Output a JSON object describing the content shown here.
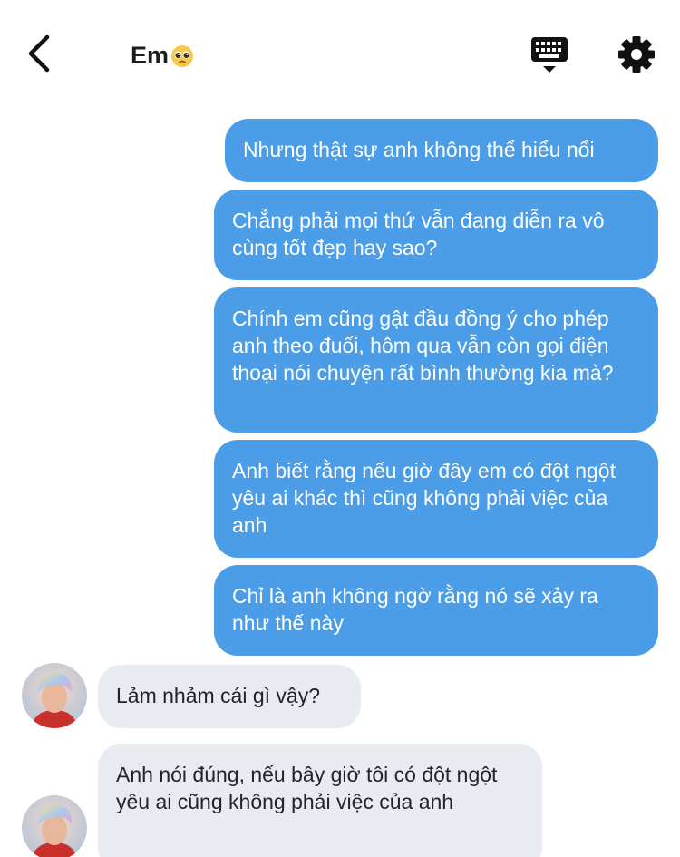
{
  "header": {
    "title": "Em",
    "title_emoji": "pleading-face-emoji",
    "back_icon": "chevron-left-icon",
    "keyboard_icon": "keyboard-icon",
    "settings_icon": "gear-icon"
  },
  "colors": {
    "outgoing_bubble": "#4b9de7",
    "incoming_bubble": "#e8ebf0"
  },
  "messages": [
    {
      "sender": "me",
      "text": "Nhưng thật sự anh không thể hiểu nổi"
    },
    {
      "sender": "me",
      "text": "Chẳng phải mọi thứ vẫn đang diễn ra vô cùng tốt đẹp hay sao?"
    },
    {
      "sender": "me",
      "text": "Chính em cũng gật đầu đồng ý cho phép anh theo đuổi, hôm qua vẫn còn gọi điện thoại nói chuyện rất bình thường kia mà?"
    },
    {
      "sender": "me",
      "text": "Anh biết rằng nếu giờ đây em có đột ngột yêu ai khác thì cũng không phải việc của anh"
    },
    {
      "sender": "me",
      "text": "Chỉ là anh không ngờ rằng nó sẽ xảy ra như thế này"
    },
    {
      "sender": "them",
      "text": "Lảm nhảm cái gì vậy?"
    },
    {
      "sender": "them",
      "text": "Anh nói đúng, nếu bây giờ tôi có đột ngột yêu ai cũng không phải việc của anh"
    }
  ]
}
